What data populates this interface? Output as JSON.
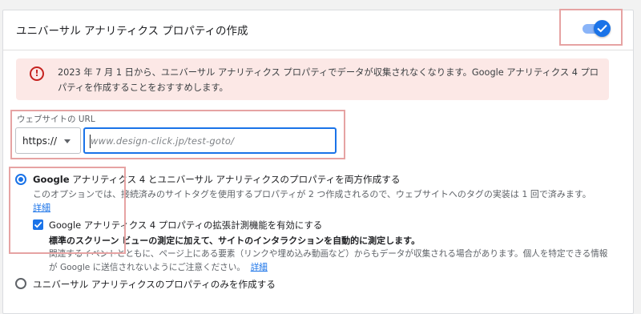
{
  "section": {
    "title": "ユニバーサル アナリティクス プロパティの作成",
    "toggle_on": true
  },
  "alert": {
    "icon": "alert-circle-icon",
    "text": "2023 年 7 月 1 日から、ユニバーサル アナリティクス プロパティでデータが収集されなくなります。Google アナリティクス 4 プロパティを作成することをおすすめします。"
  },
  "url_field": {
    "label": "ウェブサイトの URL",
    "protocol": "https://",
    "value": "www.design-click.jp/test-goto/"
  },
  "option_both": {
    "title_bold": "Google",
    "title_rest": " アナリティクス 4 とユニバーサル アナリティクスのプロパティを両方作成する",
    "description": "このオプションでは、接続済みのサイトタグを使用するプロパティが 2 つ作成されるので、ウェブサイトへのタグの実装は 1 回で済みます。",
    "link": "詳細",
    "selected": true
  },
  "enhanced_measurement": {
    "title": "Google アナリティクス 4 プロパティの拡張計測機能を有効にする",
    "desc_bold": "標準のスクリーン ビューの測定に加えて、サイトのインタラクションを自動的に測定します。",
    "desc": "関連するイベントとともに、ページ上にある要素（リンクや埋め込み動画など）からもデータが収集される場合があります。個人を特定できる情報が Google に送信されないようにご注意ください。",
    "link": "詳細",
    "checked": true
  },
  "option_ua_only": {
    "title": "ユニバーサル アナリティクスのプロパティのみを作成する",
    "selected": false
  },
  "colors": {
    "accent": "#1a73e8",
    "alert_bg": "#fce8e6",
    "alert_icon": "#c5221f",
    "highlight": "#e6a3a3"
  }
}
